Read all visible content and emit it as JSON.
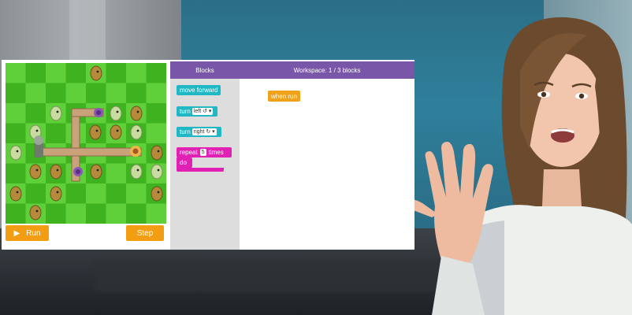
{
  "maze": {
    "buttons": {
      "run_label": "Run",
      "step_label": "Step"
    }
  },
  "toolbox": {
    "header": "Blocks",
    "blocks": {
      "move_forward": "move forward",
      "turn_left_prefix": "turn",
      "turn_left_dir": "left ↺ ▾",
      "turn_right_prefix": "turn",
      "turn_right_dir": "right ↻ ▾",
      "repeat_prefix": "repeat",
      "repeat_count": "5",
      "repeat_suffix": "times",
      "do_label": "do"
    }
  },
  "workspace": {
    "header": "Workspace: 1 / 3 blocks",
    "when_run": "when run"
  },
  "colors": {
    "header_purple": "#7a56a8",
    "button_orange": "#f39d12",
    "block_teal": "#1fb8c4",
    "block_magenta": "#e021b4",
    "block_orange": "#efa21a",
    "grass_light": "#5fd03a",
    "grass_dark": "#3eb21f"
  },
  "icons": {
    "play": "play-icon",
    "character": "zombie-character-icon",
    "goal": "sunflower-goal-icon",
    "enemy": "peashooter-icon"
  }
}
